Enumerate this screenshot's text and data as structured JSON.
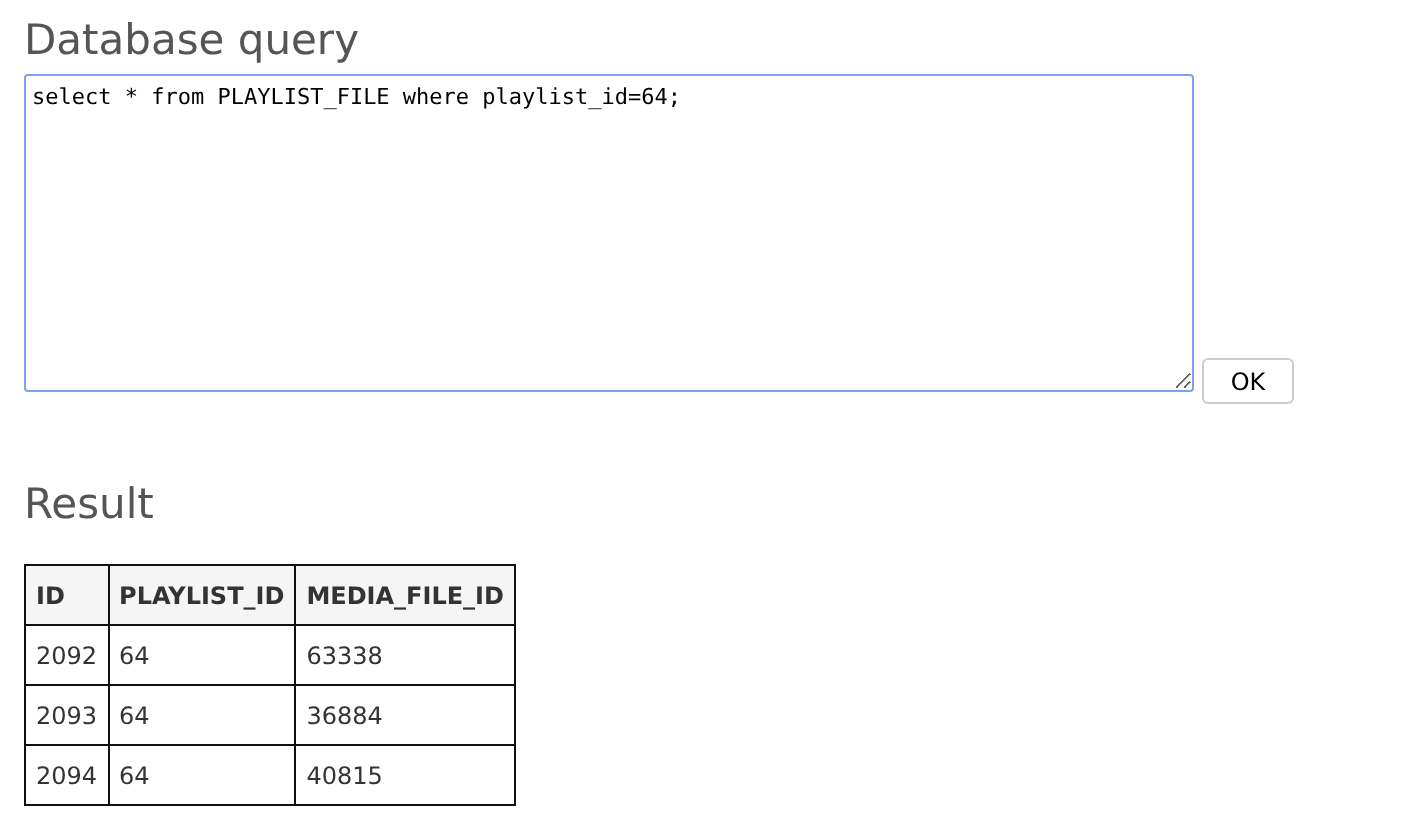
{
  "query_section": {
    "title": "Database query",
    "query": "select * from PLAYLIST_FILE where playlist_id=64;",
    "button": "OK"
  },
  "result_section": {
    "title": "Result",
    "table": {
      "columns": [
        "ID",
        "PLAYLIST_ID",
        "MEDIA_FILE_ID"
      ],
      "rows": [
        [
          "2092",
          "64",
          "63338"
        ],
        [
          "2093",
          "64",
          "36884"
        ],
        [
          "2094",
          "64",
          "40815"
        ]
      ]
    }
  }
}
